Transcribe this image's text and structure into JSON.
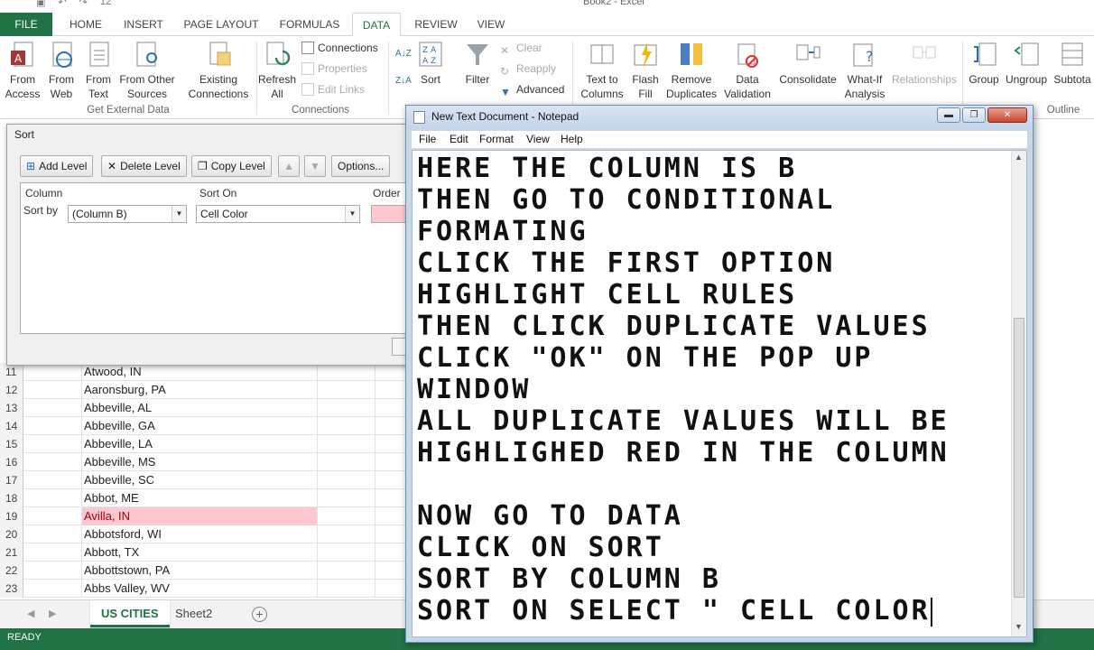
{
  "excel": {
    "title": "Book2 - Excel",
    "qat_font_size": "12",
    "ribbon_tabs": [
      {
        "label": "FILE"
      },
      {
        "label": "HOME"
      },
      {
        "label": "INSERT"
      },
      {
        "label": "PAGE LAYOUT"
      },
      {
        "label": "FORMULAS"
      },
      {
        "label": "DATA"
      },
      {
        "label": "REVIEW"
      },
      {
        "label": "VIEW"
      }
    ],
    "active_tab": "DATA",
    "ribbon": {
      "from_access": "From Access",
      "from_web": "From Web",
      "from_text": "From Text",
      "from_other_sources": "From Other Sources",
      "existing_connections": "Existing Connections",
      "refresh_all": "Refresh All",
      "connections": "Connections",
      "properties": "Properties",
      "edit_links": "Edit Links",
      "sort": "Sort",
      "filter": "Filter",
      "clear": "Clear",
      "reapply": "Reapply",
      "advanced": "Advanced",
      "text_to_columns": "Text to Columns",
      "flash_fill": "Flash Fill",
      "remove_duplicates": "Remove Duplicates",
      "data_validation": "Data Validation",
      "consolidate": "Consolidate",
      "what_if": "What-If Analysis",
      "relationships": "Relationships",
      "group": "Group",
      "ungroup": "Ungroup",
      "subtotal": "Subtota",
      "group_get_external": "Get External Data",
      "group_connections": "Connections",
      "group_outline": "Outline"
    },
    "rows": [
      {
        "num": "11",
        "value": "Atwood, IN",
        "highlight": false
      },
      {
        "num": "12",
        "value": "Aaronsburg, PA",
        "highlight": false
      },
      {
        "num": "13",
        "value": "Abbeville, AL",
        "highlight": false
      },
      {
        "num": "14",
        "value": "Abbeville, GA",
        "highlight": false
      },
      {
        "num": "15",
        "value": "Abbeville, LA",
        "highlight": false
      },
      {
        "num": "16",
        "value": "Abbeville, MS",
        "highlight": false
      },
      {
        "num": "17",
        "value": "Abbeville, SC",
        "highlight": false
      },
      {
        "num": "18",
        "value": "Abbot, ME",
        "highlight": false
      },
      {
        "num": "19",
        "value": "Avilla, IN",
        "highlight": true
      },
      {
        "num": "20",
        "value": "Abbotsford, WI",
        "highlight": false
      },
      {
        "num": "21",
        "value": "Abbott, TX",
        "highlight": false
      },
      {
        "num": "22",
        "value": "Abbottstown, PA",
        "highlight": false
      },
      {
        "num": "23",
        "value": "Abbs Valley, WV",
        "highlight": false
      }
    ],
    "sheet_tabs": [
      {
        "label": "US CITIES",
        "active": true
      },
      {
        "label": "Sheet2",
        "active": false
      }
    ],
    "status": "READY",
    "highlight_color": "#ffc7ce",
    "accent_color": "#217346"
  },
  "sort_dialog": {
    "title": "Sort",
    "add_level": "Add Level",
    "delete_level": "Delete Level",
    "copy_level": "Copy Level",
    "options": "Options...",
    "col_header": "Column",
    "sorton_header": "Sort On",
    "order_header": "Order",
    "sort_by_label": "Sort by",
    "column_value": "(Column B)",
    "sort_on_value": "Cell Color"
  },
  "notepad": {
    "title": "New Text Document - Notepad",
    "menu": [
      "File",
      "Edit",
      "Format",
      "View",
      "Help"
    ],
    "lines": [
      "HERE THE COLUMN IS B",
      "THEN GO TO CONDITIONAL",
      "FORMATING",
      "CLICK THE FIRST OPTION",
      "HIGHLIGHT CELL RULES",
      "THEN CLICK DUPLICATE VALUES",
      "CLICK \"OK\" ON THE POP UP",
      "WINDOW",
      "ALL DUPLICATE VALUES WILL BE",
      "HIGHLIGHED RED IN THE COLUMN",
      "",
      "NOW GO TO DATA",
      "CLICK ON SORT",
      "SORT BY COLUMN B",
      "SORT ON SELECT \" CELL COLOR"
    ]
  }
}
